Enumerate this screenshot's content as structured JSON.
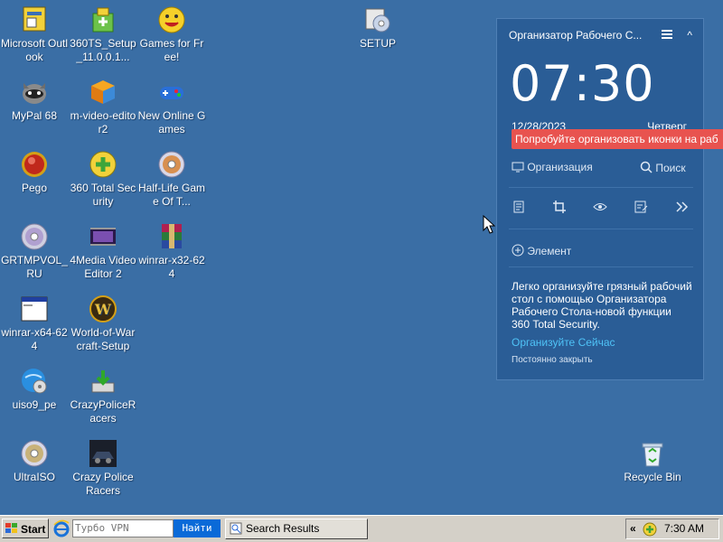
{
  "desktop_icons": [
    {
      "label": "Microsoft Outlook"
    },
    {
      "label": "360TS_Setup_11.0.0.1..."
    },
    {
      "label": "Games for Free!"
    },
    {
      "label": "SETUP"
    },
    {
      "label": "MyPal 68"
    },
    {
      "label": "m-video-editor2"
    },
    {
      "label": "New Online Games"
    },
    {
      "label": "Pego"
    },
    {
      "label": "360 Total Security"
    },
    {
      "label": "Half-Life Game Of T..."
    },
    {
      "label": "GRTMPVOL_RU"
    },
    {
      "label": "4Media Video Editor 2"
    },
    {
      "label": "winrar-x32-624"
    },
    {
      "label": "winrar-x64-624"
    },
    {
      "label": "World-of-Warcraft-Setup"
    },
    {
      "label": "uiso9_pe"
    },
    {
      "label": "CrazyPoliceRacers"
    },
    {
      "label": "UltraISO"
    },
    {
      "label": "Crazy Police Racers"
    },
    {
      "label": "Recycle Bin"
    }
  ],
  "widget": {
    "title": "Организатор Рабочего С...",
    "collapse": "^",
    "time": "07:30",
    "date": "12/28/2023",
    "day": "Четверг",
    "tip": "Попробуйте организовать иконки на раб",
    "organize": "Организация",
    "search": "Поиск",
    "element": "Элемент",
    "description": "Легко организуйте грязный рабочий стол с помощью Организатора Рабочего Стола-новой функции 360 Total Security.",
    "organize_now": "Организуйте Сейчас",
    "close_forever": "Постоянно закрыть",
    "accent": "#2a5d96",
    "tip_color": "#e8534f",
    "link_color": "#4fc3f7"
  },
  "taskbar": {
    "start": "Start",
    "search_text": "Турбо VPN",
    "go": "Найти",
    "task": "Search Results",
    "tray_chevron": "«",
    "clock": "7:30 AM"
  }
}
